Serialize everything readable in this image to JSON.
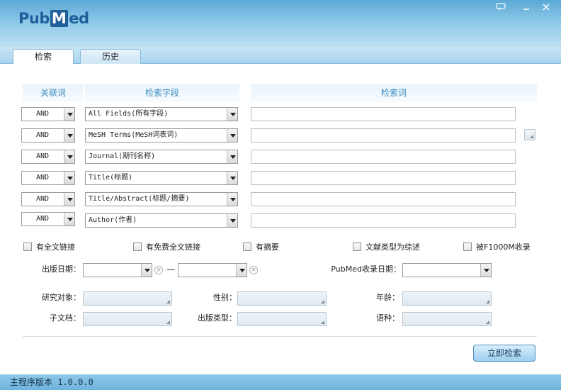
{
  "app": {
    "logo_left": "Pub",
    "logo_box": "M",
    "logo_right": "ed"
  },
  "window_controls": [
    "chat-bubble-icon",
    "minimize-icon",
    "close-icon"
  ],
  "tabs": [
    {
      "label": "检索",
      "active": true
    },
    {
      "label": "历史",
      "active": false
    }
  ],
  "headers": {
    "operator": "关联词",
    "field": "检索字段",
    "term": "检索词"
  },
  "rows": [
    {
      "op": "AND",
      "field": "All Fields(所有字段)",
      "term": ""
    },
    {
      "op": "AND",
      "field": "MeSH Terms(MeSH词表词)",
      "term": ""
    },
    {
      "op": "AND",
      "field": "Journal(期刊名称)",
      "term": ""
    },
    {
      "op": "AND",
      "field": "Title(标题)",
      "term": ""
    },
    {
      "op": "AND",
      "field": "Title/Abstract(标题/摘要)",
      "term": ""
    },
    {
      "op": "AND",
      "field": "Author(作者)",
      "term": ""
    }
  ],
  "checkboxes": [
    "有全文链接",
    "有免费全文链接",
    "有摘要",
    "文献类型为综述",
    "被F1000M收录"
  ],
  "filters": {
    "pub_date_label": "出版日期：",
    "pub_date_from": "",
    "pub_date_to": "",
    "date_separator": "—",
    "pubmed_date_label": "PubMed收录日期：",
    "pubmed_date": "",
    "subject_label": "研究对象：",
    "gender_label": "性别：",
    "age_label": "年龄：",
    "subset_label": "子文档：",
    "pubtype_label": "出版类型：",
    "language_label": "语种："
  },
  "search_button": "立即检索",
  "status": "主程序版本 1.0.0.0",
  "colors": {
    "title_blue": "#5aa8d6",
    "accent_text": "#3b8bbf",
    "button_border": "#4b8ebf"
  }
}
